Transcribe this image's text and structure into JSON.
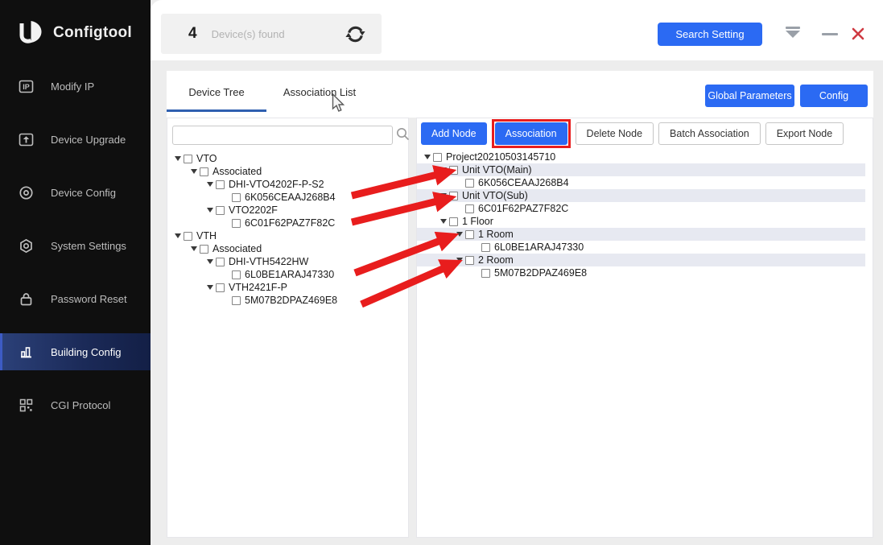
{
  "app": {
    "brand": "Configtool"
  },
  "topbar": {
    "device_count": "4",
    "device_found_label": "Device(s) found",
    "search_setting_label": "Search Setting"
  },
  "sidebar": {
    "items": [
      {
        "label": "Modify IP",
        "icon": "ip-icon",
        "active": false
      },
      {
        "label": "Device Upgrade",
        "icon": "upgrade-icon",
        "active": false
      },
      {
        "label": "Device Config",
        "icon": "target-icon",
        "active": false
      },
      {
        "label": "System Settings",
        "icon": "gear-icon",
        "active": false
      },
      {
        "label": "Password Reset",
        "icon": "lock-icon",
        "active": false
      },
      {
        "label": "Building Config",
        "icon": "building-icon",
        "active": true
      },
      {
        "label": "CGI Protocol",
        "icon": "qr-icon",
        "active": false
      }
    ]
  },
  "tabs": {
    "device_tree": "Device Tree",
    "association_list": "Association List",
    "active": "Device Tree"
  },
  "header_actions": {
    "global_parameters": "Global Parameters",
    "config": "Config"
  },
  "left_panel": {
    "search_value": "",
    "search_placeholder": "",
    "tree": [
      {
        "label": "VTO",
        "level": 0,
        "caret": true
      },
      {
        "label": "Associated",
        "level": 1,
        "caret": true
      },
      {
        "label": "DHI-VTO4202F-P-S2",
        "level": 2,
        "caret": true
      },
      {
        "label": "6K056CEAAJ268B4",
        "level": 3,
        "caret": false
      },
      {
        "label": "VTO2202F",
        "level": 2,
        "caret": true
      },
      {
        "label": "6C01F62PAZ7F82C",
        "level": 3,
        "caret": false
      },
      {
        "label": "VTH",
        "level": 0,
        "caret": true
      },
      {
        "label": "Associated",
        "level": 1,
        "caret": true
      },
      {
        "label": "DHI-VTH5422HW",
        "level": 2,
        "caret": true
      },
      {
        "label": "6L0BE1ARAJ47330",
        "level": 3,
        "caret": false
      },
      {
        "label": "VTH2421F-P",
        "level": 2,
        "caret": true
      },
      {
        "label": "5M07B2DPAZ469E8",
        "level": 3,
        "caret": false
      }
    ]
  },
  "right_panel": {
    "buttons": [
      {
        "label": "Add Node",
        "style": "primary"
      },
      {
        "label": "Association",
        "style": "primary",
        "annotated": true
      },
      {
        "label": "Delete Node",
        "style": "default"
      },
      {
        "label": "Batch Association",
        "style": "default"
      },
      {
        "label": "Export Node",
        "style": "default"
      }
    ],
    "tree": [
      {
        "label": "Project20210503145710",
        "level": 0,
        "caret": true,
        "highlight": false
      },
      {
        "label": "Unit VTO(Main)",
        "level": 1,
        "caret": true,
        "highlight": true
      },
      {
        "label": "6K056CEAAJ268B4",
        "level": 2,
        "caret": false,
        "highlight": false
      },
      {
        "label": "Unit VTO(Sub)",
        "level": 1,
        "caret": true,
        "highlight": true
      },
      {
        "label": "6C01F62PAZ7F82C",
        "level": 2,
        "caret": false,
        "highlight": false
      },
      {
        "label": "1 Floor",
        "level": 1,
        "caret": true,
        "highlight": false
      },
      {
        "label": "1 Room",
        "level": 2,
        "caret": true,
        "highlight": true
      },
      {
        "label": "6L0BE1ARAJ47330",
        "level": 3,
        "caret": false,
        "highlight": false
      },
      {
        "label": "2 Room",
        "level": 2,
        "caret": true,
        "highlight": true
      },
      {
        "label": "5M07B2DPAZ469E8",
        "level": 3,
        "caret": false,
        "highlight": false
      }
    ]
  },
  "colors": {
    "accent": "#2b6af3",
    "annotation_red": "#e81d1d",
    "row_highlight": "#e7e9f1",
    "tab_underline": "#2f5fb0",
    "close_red": "#cf3a42"
  }
}
